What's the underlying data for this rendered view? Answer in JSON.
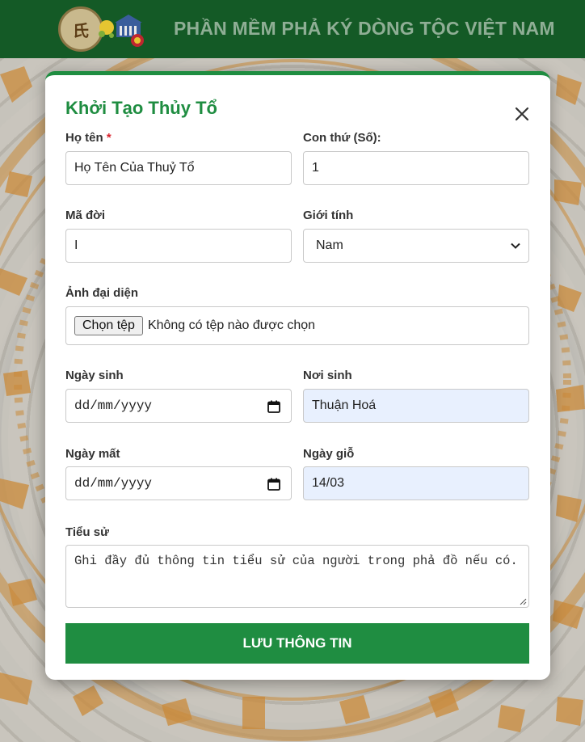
{
  "header": {
    "title": "PHẦN MỀM PHẢ KÝ DÒNG TỘC VIỆT NAM",
    "logo_text": "氏"
  },
  "modal": {
    "title": "Khởi Tạo Thủy Tổ",
    "required_mark": "*",
    "fields": {
      "full_name": {
        "label": "Họ tên",
        "value": "Họ Tên Của Thuỷ Tổ"
      },
      "child_order": {
        "label": "Con thứ (Số):",
        "value": "1"
      },
      "generation": {
        "label": "Mã đời",
        "value": "I"
      },
      "gender": {
        "label": "Giới tính",
        "value": "Nam"
      },
      "avatar": {
        "label": "Ảnh đại diện",
        "button": "Chọn tệp",
        "status": "Không có tệp nào được chọn"
      },
      "birth_date": {
        "label": "Ngày sinh",
        "placeholder": "dd/mm/yyyy"
      },
      "birth_place": {
        "label": "Nơi sinh",
        "value": "Thuận Hoá"
      },
      "death_date": {
        "label": "Ngày mất",
        "placeholder": "dd/mm/yyyy"
      },
      "memorial_day": {
        "label": "Ngày giỗ",
        "value": "14/03"
      },
      "biography": {
        "label": "Tiểu sử",
        "placeholder": "Ghi đầy đủ thông tin tiểu sử của người trong phả đồ nếu có."
      }
    },
    "save_label": "LƯU THÔNG TIN"
  },
  "colors": {
    "header_bg": "#145a26",
    "accent": "#1f8d41",
    "autofill_bg": "#e8f0fe"
  }
}
